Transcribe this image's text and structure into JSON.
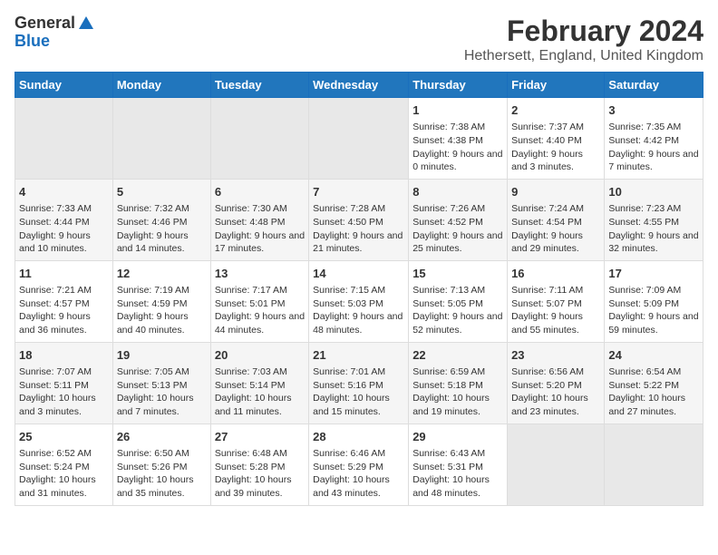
{
  "logo": {
    "general": "General",
    "blue": "Blue"
  },
  "title": "February 2024",
  "subtitle": "Hethersett, England, United Kingdom",
  "headers": [
    "Sunday",
    "Monday",
    "Tuesday",
    "Wednesday",
    "Thursday",
    "Friday",
    "Saturday"
  ],
  "weeks": [
    [
      {
        "day": "",
        "info": ""
      },
      {
        "day": "",
        "info": ""
      },
      {
        "day": "",
        "info": ""
      },
      {
        "day": "",
        "info": ""
      },
      {
        "day": "1",
        "info": "Sunrise: 7:38 AM\nSunset: 4:38 PM\nDaylight: 9 hours and 0 minutes."
      },
      {
        "day": "2",
        "info": "Sunrise: 7:37 AM\nSunset: 4:40 PM\nDaylight: 9 hours and 3 minutes."
      },
      {
        "day": "3",
        "info": "Sunrise: 7:35 AM\nSunset: 4:42 PM\nDaylight: 9 hours and 7 minutes."
      }
    ],
    [
      {
        "day": "4",
        "info": "Sunrise: 7:33 AM\nSunset: 4:44 PM\nDaylight: 9 hours and 10 minutes."
      },
      {
        "day": "5",
        "info": "Sunrise: 7:32 AM\nSunset: 4:46 PM\nDaylight: 9 hours and 14 minutes."
      },
      {
        "day": "6",
        "info": "Sunrise: 7:30 AM\nSunset: 4:48 PM\nDaylight: 9 hours and 17 minutes."
      },
      {
        "day": "7",
        "info": "Sunrise: 7:28 AM\nSunset: 4:50 PM\nDaylight: 9 hours and 21 minutes."
      },
      {
        "day": "8",
        "info": "Sunrise: 7:26 AM\nSunset: 4:52 PM\nDaylight: 9 hours and 25 minutes."
      },
      {
        "day": "9",
        "info": "Sunrise: 7:24 AM\nSunset: 4:54 PM\nDaylight: 9 hours and 29 minutes."
      },
      {
        "day": "10",
        "info": "Sunrise: 7:23 AM\nSunset: 4:55 PM\nDaylight: 9 hours and 32 minutes."
      }
    ],
    [
      {
        "day": "11",
        "info": "Sunrise: 7:21 AM\nSunset: 4:57 PM\nDaylight: 9 hours and 36 minutes."
      },
      {
        "day": "12",
        "info": "Sunrise: 7:19 AM\nSunset: 4:59 PM\nDaylight: 9 hours and 40 minutes."
      },
      {
        "day": "13",
        "info": "Sunrise: 7:17 AM\nSunset: 5:01 PM\nDaylight: 9 hours and 44 minutes."
      },
      {
        "day": "14",
        "info": "Sunrise: 7:15 AM\nSunset: 5:03 PM\nDaylight: 9 hours and 48 minutes."
      },
      {
        "day": "15",
        "info": "Sunrise: 7:13 AM\nSunset: 5:05 PM\nDaylight: 9 hours and 52 minutes."
      },
      {
        "day": "16",
        "info": "Sunrise: 7:11 AM\nSunset: 5:07 PM\nDaylight: 9 hours and 55 minutes."
      },
      {
        "day": "17",
        "info": "Sunrise: 7:09 AM\nSunset: 5:09 PM\nDaylight: 9 hours and 59 minutes."
      }
    ],
    [
      {
        "day": "18",
        "info": "Sunrise: 7:07 AM\nSunset: 5:11 PM\nDaylight: 10 hours and 3 minutes."
      },
      {
        "day": "19",
        "info": "Sunrise: 7:05 AM\nSunset: 5:13 PM\nDaylight: 10 hours and 7 minutes."
      },
      {
        "day": "20",
        "info": "Sunrise: 7:03 AM\nSunset: 5:14 PM\nDaylight: 10 hours and 11 minutes."
      },
      {
        "day": "21",
        "info": "Sunrise: 7:01 AM\nSunset: 5:16 PM\nDaylight: 10 hours and 15 minutes."
      },
      {
        "day": "22",
        "info": "Sunrise: 6:59 AM\nSunset: 5:18 PM\nDaylight: 10 hours and 19 minutes."
      },
      {
        "day": "23",
        "info": "Sunrise: 6:56 AM\nSunset: 5:20 PM\nDaylight: 10 hours and 23 minutes."
      },
      {
        "day": "24",
        "info": "Sunrise: 6:54 AM\nSunset: 5:22 PM\nDaylight: 10 hours and 27 minutes."
      }
    ],
    [
      {
        "day": "25",
        "info": "Sunrise: 6:52 AM\nSunset: 5:24 PM\nDaylight: 10 hours and 31 minutes."
      },
      {
        "day": "26",
        "info": "Sunrise: 6:50 AM\nSunset: 5:26 PM\nDaylight: 10 hours and 35 minutes."
      },
      {
        "day": "27",
        "info": "Sunrise: 6:48 AM\nSunset: 5:28 PM\nDaylight: 10 hours and 39 minutes."
      },
      {
        "day": "28",
        "info": "Sunrise: 6:46 AM\nSunset: 5:29 PM\nDaylight: 10 hours and 43 minutes."
      },
      {
        "day": "29",
        "info": "Sunrise: 6:43 AM\nSunset: 5:31 PM\nDaylight: 10 hours and 48 minutes."
      },
      {
        "day": "",
        "info": ""
      },
      {
        "day": "",
        "info": ""
      }
    ]
  ]
}
